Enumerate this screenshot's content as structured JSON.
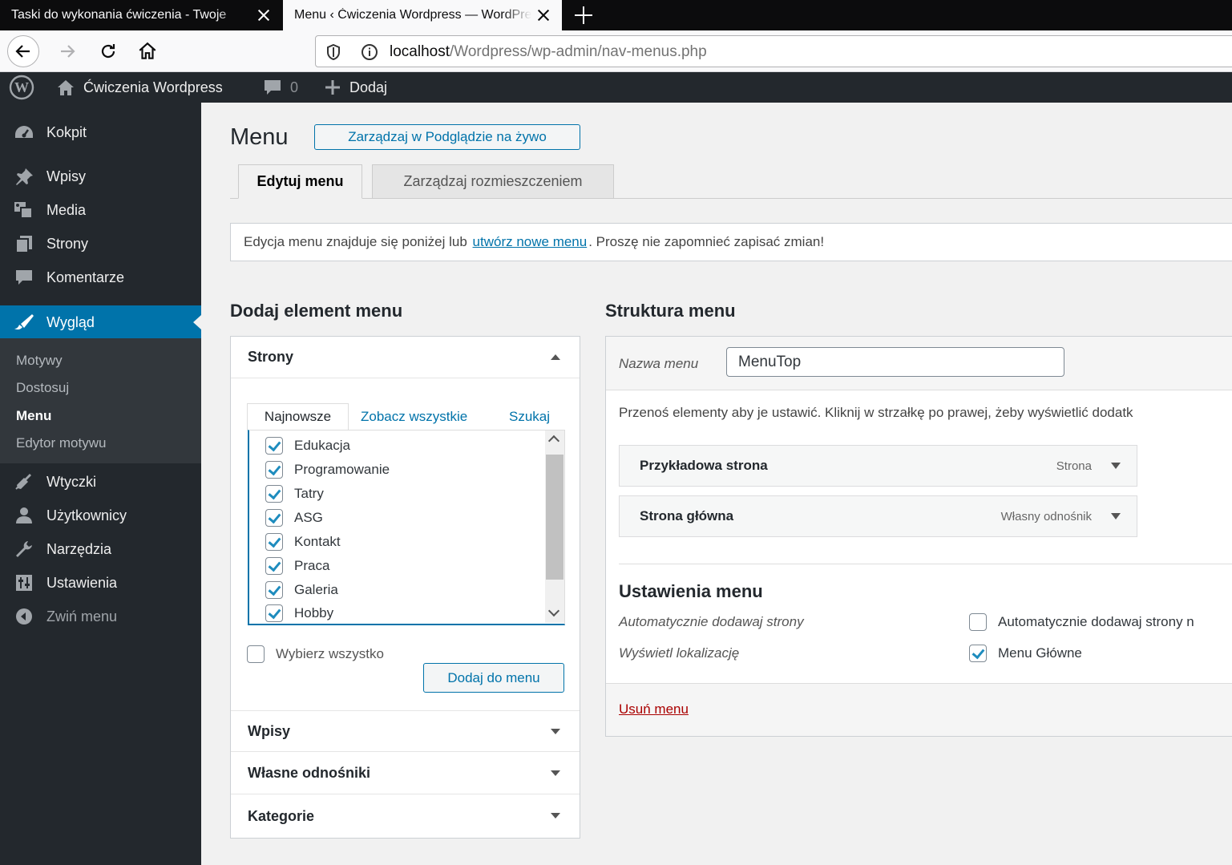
{
  "browser": {
    "tabs": [
      {
        "title": "Taski do wykonania ćwiczenia - Twoje",
        "active": false
      },
      {
        "title": "Menu ‹ Ćwiczenia Wordpress — WordPress",
        "active": true
      }
    ],
    "url": {
      "host": "localhost",
      "path": "/Wordpress/wp-admin/nav-menus.php"
    }
  },
  "adminbar": {
    "site_name": "Ćwiczenia Wordpress",
    "comments_count": "0",
    "new_label": "Dodaj"
  },
  "sidebar": {
    "items": [
      {
        "label": "Kokpit",
        "icon": "dashboard-icon"
      },
      {
        "label": "Wpisy",
        "icon": "pin-icon"
      },
      {
        "label": "Media",
        "icon": "media-icon"
      },
      {
        "label": "Strony",
        "icon": "pages-icon"
      },
      {
        "label": "Komentarze",
        "icon": "comment-icon"
      },
      {
        "label": "Wygląd",
        "icon": "brush-icon",
        "current": true
      },
      {
        "label": "Wtyczki",
        "icon": "plugin-icon"
      },
      {
        "label": "Użytkownicy",
        "icon": "users-icon"
      },
      {
        "label": "Narzędzia",
        "icon": "wrench-icon"
      },
      {
        "label": "Ustawienia",
        "icon": "settings-icon"
      },
      {
        "label": "Zwiń menu",
        "icon": "collapse-icon"
      }
    ],
    "submenu": [
      "Motywy",
      "Dostosuj",
      "Menu",
      "Edytor motywu"
    ],
    "submenu_current": "Menu"
  },
  "main": {
    "title": "Menu",
    "live_button": "Zarządzaj w Podglądzie na żywo",
    "tabs": [
      "Edytuj menu",
      "Zarządzaj rozmieszczeniem"
    ],
    "notice": {
      "before": "Edycja menu znajduje się poniżej lub",
      "link": "utwórz nowe menu",
      "after": ". Proszę nie zapomnieć zapisać zmian!"
    }
  },
  "add_items": {
    "heading": "Dodaj element menu",
    "panels": [
      "Strony",
      "Wpisy",
      "Własne odnośniki",
      "Kategorie"
    ],
    "subtabs": [
      "Najnowsze",
      "Zobacz wszystkie",
      "Szukaj"
    ],
    "pages": [
      {
        "label": "Edukacja",
        "checked": true
      },
      {
        "label": "Programowanie",
        "checked": true
      },
      {
        "label": "Tatry",
        "checked": true
      },
      {
        "label": "ASG",
        "checked": true
      },
      {
        "label": "Kontakt",
        "checked": true
      },
      {
        "label": "Praca",
        "checked": true
      },
      {
        "label": "Galeria",
        "checked": true
      },
      {
        "label": "Hobby",
        "checked": true
      }
    ],
    "select_all": "Wybierz wszystko",
    "add_button": "Dodaj do menu"
  },
  "structure": {
    "heading": "Struktura menu",
    "name_label": "Nazwa menu",
    "name_value": "MenuTop",
    "hint": "Przenoś elementy aby je ustawić. Kliknij w strzałkę po prawej, żeby wyświetlić dodatk",
    "items": [
      {
        "title": "Przykładowa strona",
        "type": "Strona"
      },
      {
        "title": "Strona główna",
        "type": "Własny odnośnik"
      }
    ],
    "settings_heading": "Ustawienia menu",
    "auto_add_label": "Automatycznie dodawaj strony",
    "auto_add_option": "Automatycznie dodawaj strony n",
    "auto_add_checked": false,
    "location_label": "Wyświetl lokalizację",
    "location_option": "Menu Główne",
    "location_checked": true,
    "delete_link": "Usuń menu"
  },
  "colors": {
    "accent": "#0073aa",
    "sidebar_bg": "#23282d",
    "delete": "#a00000"
  }
}
